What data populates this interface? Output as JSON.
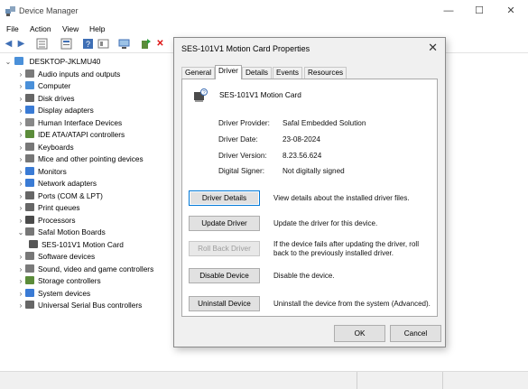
{
  "window": {
    "title": "Device Manager",
    "controls": [
      "—",
      "☐",
      "✕"
    ]
  },
  "menu": [
    "File",
    "Action",
    "View",
    "Help"
  ],
  "tree": {
    "root": "DESKTOP-JKLMU40",
    "items": [
      {
        "label": "Audio inputs and outputs",
        "icon": "speaker-icon",
        "color": "#7a7a7a"
      },
      {
        "label": "Computer",
        "icon": "computer-icon",
        "color": "#4a90d9"
      },
      {
        "label": "Disk drives",
        "icon": "disk-icon",
        "color": "#666666"
      },
      {
        "label": "Display adapters",
        "icon": "display-icon",
        "color": "#3a7bd5"
      },
      {
        "label": "Human Interface Devices",
        "icon": "hid-icon",
        "color": "#888888"
      },
      {
        "label": "IDE ATA/ATAPI controllers",
        "icon": "ide-icon",
        "color": "#5b8c3a"
      },
      {
        "label": "Keyboards",
        "icon": "keyboard-icon",
        "color": "#777777"
      },
      {
        "label": "Mice and other pointing devices",
        "icon": "mouse-icon",
        "color": "#777777"
      },
      {
        "label": "Monitors",
        "icon": "monitor-icon",
        "color": "#3a7bd5"
      },
      {
        "label": "Network adapters",
        "icon": "network-icon",
        "color": "#3a7bd5"
      },
      {
        "label": "Ports (COM & LPT)",
        "icon": "port-icon",
        "color": "#666666"
      },
      {
        "label": "Print queues",
        "icon": "printer-icon",
        "color": "#666666"
      },
      {
        "label": "Processors",
        "icon": "processor-icon",
        "color": "#4b4b4b"
      },
      {
        "label": "Safal Motion Boards",
        "icon": "board-icon",
        "color": "#777777"
      },
      {
        "label": "SES-101V1 Motion Card",
        "icon": "card-icon",
        "color": "#555555"
      },
      {
        "label": "Software devices",
        "icon": "software-icon",
        "color": "#777777"
      },
      {
        "label": "Sound, video and game controllers",
        "icon": "sound-icon",
        "color": "#7a7a7a"
      },
      {
        "label": "Storage controllers",
        "icon": "storage-icon",
        "color": "#5b8c3a"
      },
      {
        "label": "System devices",
        "icon": "system-icon",
        "color": "#3a7bd5"
      },
      {
        "label": "Universal Serial Bus controllers",
        "icon": "usb-icon",
        "color": "#666666"
      }
    ]
  },
  "dialog": {
    "title": "SES-101V1 Motion Card Properties",
    "tabs": [
      "General",
      "Driver",
      "Details",
      "Events",
      "Resources"
    ],
    "device_name": "SES-101V1 Motion Card",
    "fields": [
      {
        "label": "Driver Provider:",
        "value": "Safal Embedded Solution"
      },
      {
        "label": "Driver Date:",
        "value": "23-08-2024"
      },
      {
        "label": "Driver Version:",
        "value": "8.23.56.624"
      },
      {
        "label": "Digital Signer:",
        "value": "Not digitally signed"
      }
    ],
    "actions": [
      {
        "label": "Driver Details",
        "desc": "View details about the installed driver files."
      },
      {
        "label": "Update Driver",
        "desc": "Update the driver for this device."
      },
      {
        "label": "Roll Back Driver",
        "desc": "If the device fails after updating the driver, roll back to the previously installed driver."
      },
      {
        "label": "Disable Device",
        "desc": "Disable the device."
      },
      {
        "label": "Uninstall Device",
        "desc": "Uninstall the device from the system (Advanced)."
      }
    ],
    "ok": "OK",
    "cancel": "Cancel"
  }
}
